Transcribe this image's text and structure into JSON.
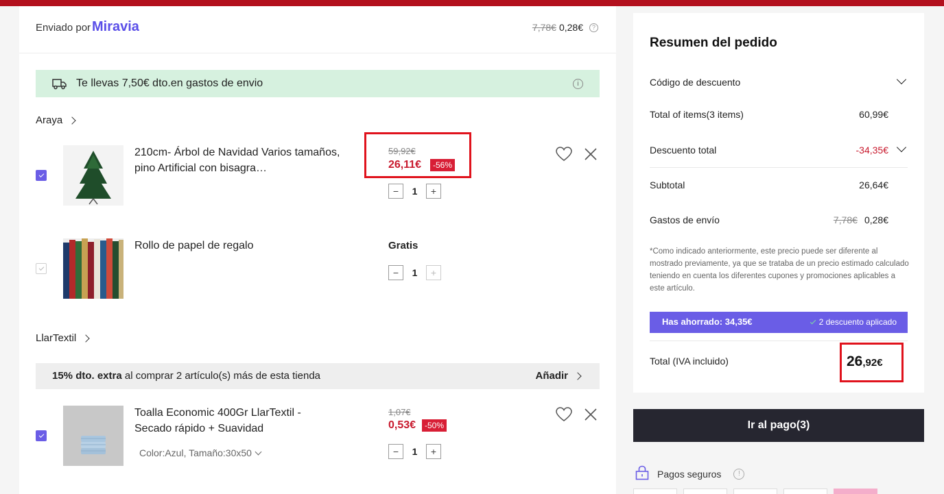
{
  "shipping": {
    "sent_by": "Enviado por",
    "brand": "Miravia",
    "old_fee": "7,78€",
    "fee": "0,28€",
    "help": "?"
  },
  "banner": {
    "text": "Te llevas 7,50€ dto.en gastos de envio",
    "info": "i"
  },
  "stores": [
    {
      "name": "Araya",
      "items": [
        {
          "name": "210cm- Árbol de Navidad Varios tamaños, pino Artificial con bisagra…",
          "old_price": "59,92€",
          "price": "26,11€",
          "discount": "-56%",
          "qty": "1",
          "checked": true
        },
        {
          "name": "Rollo de papel de regalo",
          "price": "Gratis",
          "qty": "1",
          "checked": false
        }
      ]
    },
    {
      "name": "LlarTextil",
      "promo": {
        "bold": "15% dto. extra",
        "rest": " al comprar 2 artículo(s) más de esta tienda",
        "action": "Añadir"
      },
      "items": [
        {
          "name": "Toalla Economic 400Gr LlarTextil - Secado rápido + Suavidad",
          "variant": "Color:Azul, Tamaño:30x50",
          "old_price": "1,07€",
          "price": "0,53€",
          "discount": "-50%",
          "qty": "1",
          "checked": true
        }
      ]
    }
  ],
  "stepper": {
    "minus": "−",
    "plus": "+"
  },
  "summary": {
    "title": "Resumen del pedido",
    "discount_code": "Código de descuento",
    "items_label": "Total of items(3 items)",
    "items_value": "60,99€",
    "total_discount_label": "Descuento total",
    "total_discount_value": "-34,35€",
    "subtotal_label": "Subtotal",
    "subtotal_value": "26,64€",
    "shipping_label": "Gastos de envío",
    "shipping_old": "7,78€",
    "shipping_value": "0,28€",
    "note": "*Como indicado anteriormente, este precio puede ser diferente al mostrado previamente, ya que se trataba de un precio estimado calculado teniendo en cuenta los diferentes cupones y promociones aplicables a este artículo.",
    "saved_label": "Has ahorrado:",
    "saved_value": "34,35€",
    "applied": "2 descuento aplicado",
    "total_label": "Total (IVA incluido)",
    "total_int": "26",
    "total_dec": ",92€"
  },
  "checkout": {
    "label": "Ir al pago(3)"
  },
  "secure": {
    "label": "Pagos seguros",
    "help": "!"
  },
  "colors": {
    "accent": "#6a5de6",
    "price_red": "#c8192d",
    "brand_bar": "#b3101d",
    "checkout": "#262630"
  }
}
